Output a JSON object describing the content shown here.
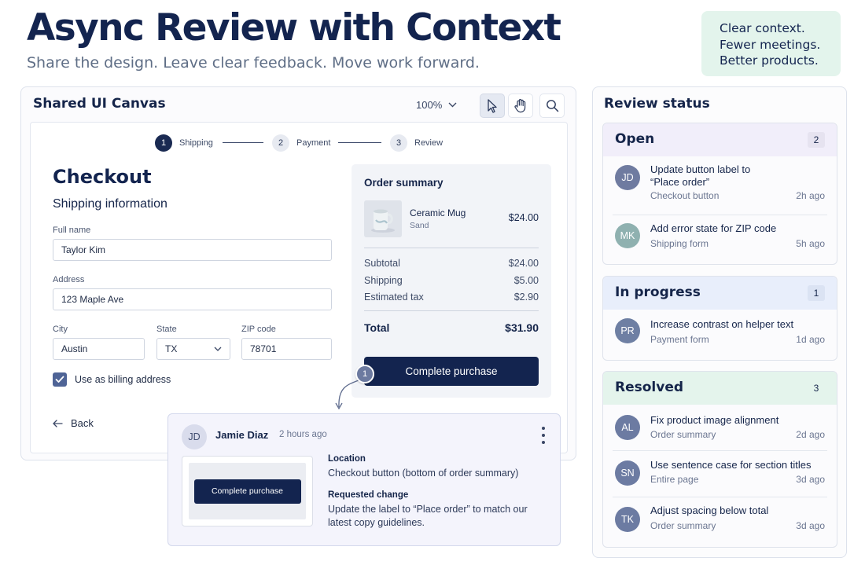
{
  "header": {
    "title": "Async Review with Context",
    "subtitle": "Share the design. Leave clear feedback. Move work forward.",
    "callout": [
      "Clear context.",
      "Fewer meetings.",
      "Better products."
    ]
  },
  "canvas": {
    "title": "Shared UI Canvas",
    "zoom": "100%",
    "tools": [
      "pointer-tool",
      "hand-tool",
      "search-tool"
    ],
    "steps": [
      {
        "num": "1",
        "label": "Shipping",
        "active": true
      },
      {
        "num": "2",
        "label": "Payment",
        "active": false
      },
      {
        "num": "3",
        "label": "Review",
        "active": false
      }
    ],
    "checkout": {
      "title": "Checkout",
      "subtitle": "Shipping information",
      "fields": {
        "full_name": {
          "label": "Full name",
          "value": "Taylor Kim"
        },
        "address": {
          "label": "Address",
          "value": "123 Maple Ave"
        },
        "city": {
          "label": "City",
          "value": "Austin"
        },
        "state": {
          "label": "State",
          "value": "TX"
        },
        "zip": {
          "label": "ZIP code",
          "value": "78701"
        }
      },
      "billing_checkbox": {
        "label": "Use as billing address",
        "checked": true
      },
      "back_label": "Back"
    },
    "summary": {
      "title": "Order summary",
      "product": {
        "name": "Ceramic Mug",
        "variant": "Sand",
        "price": "$24.00"
      },
      "rows": [
        {
          "label": "Subtotal",
          "value": "$24.00"
        },
        {
          "label": "Shipping",
          "value": "$5.00"
        },
        {
          "label": "Estimated tax",
          "value": "$2.90"
        }
      ],
      "total": {
        "label": "Total",
        "value": "$31.90"
      },
      "cta": "Complete purchase"
    },
    "pin": "1"
  },
  "comment": {
    "initials": "JD",
    "author": "Jamie Diaz",
    "time": "2 hours ago",
    "preview_button": "Complete purchase",
    "location_heading": "Location",
    "location_text": "Checkout button (bottom of order summary)",
    "change_heading": "Requested change",
    "change_text": "Update the label to “Place order” to match our latest copy guidelines."
  },
  "review": {
    "title": "Review status",
    "groups": [
      {
        "name": "Open",
        "count": "2",
        "head_color": "#f1eefa",
        "count_bg": "#e6e3f0",
        "items": [
          {
            "initials": "JD",
            "avatar_color": "#6f7ba0",
            "title": "Update button label to “Place order”",
            "meta": "Checkout button",
            "age": "2h ago"
          },
          {
            "initials": "MK",
            "avatar_color": "#8fb1b0",
            "title": "Add error state for ZIP code",
            "meta": "Shipping form",
            "age": "5h ago"
          }
        ]
      },
      {
        "name": "In progress",
        "count": "1",
        "head_color": "#e8eefb",
        "count_bg": "#dbe3f3",
        "items": [
          {
            "initials": "PR",
            "avatar_color": "#6e7fa3",
            "title": "Increase contrast on helper text",
            "meta": "Payment form",
            "age": "1d ago"
          }
        ]
      },
      {
        "name": "Resolved",
        "count": "3",
        "head_color": "#e4f4ec",
        "count_bg": "#e4f4ec",
        "items": [
          {
            "initials": "AL",
            "avatar_color": "#6c7ba2",
            "title": "Fix product image alignment",
            "meta": "Order summary",
            "age": "2d ago"
          },
          {
            "initials": "SN",
            "avatar_color": "#6c7ba2",
            "title": "Use sentence case for section titles",
            "meta": "Entire page",
            "age": "3d ago"
          },
          {
            "initials": "TK",
            "avatar_color": "#6c7ba2",
            "title": "Adjust spacing below total",
            "meta": "Order summary",
            "age": "3d ago"
          }
        ]
      }
    ]
  }
}
